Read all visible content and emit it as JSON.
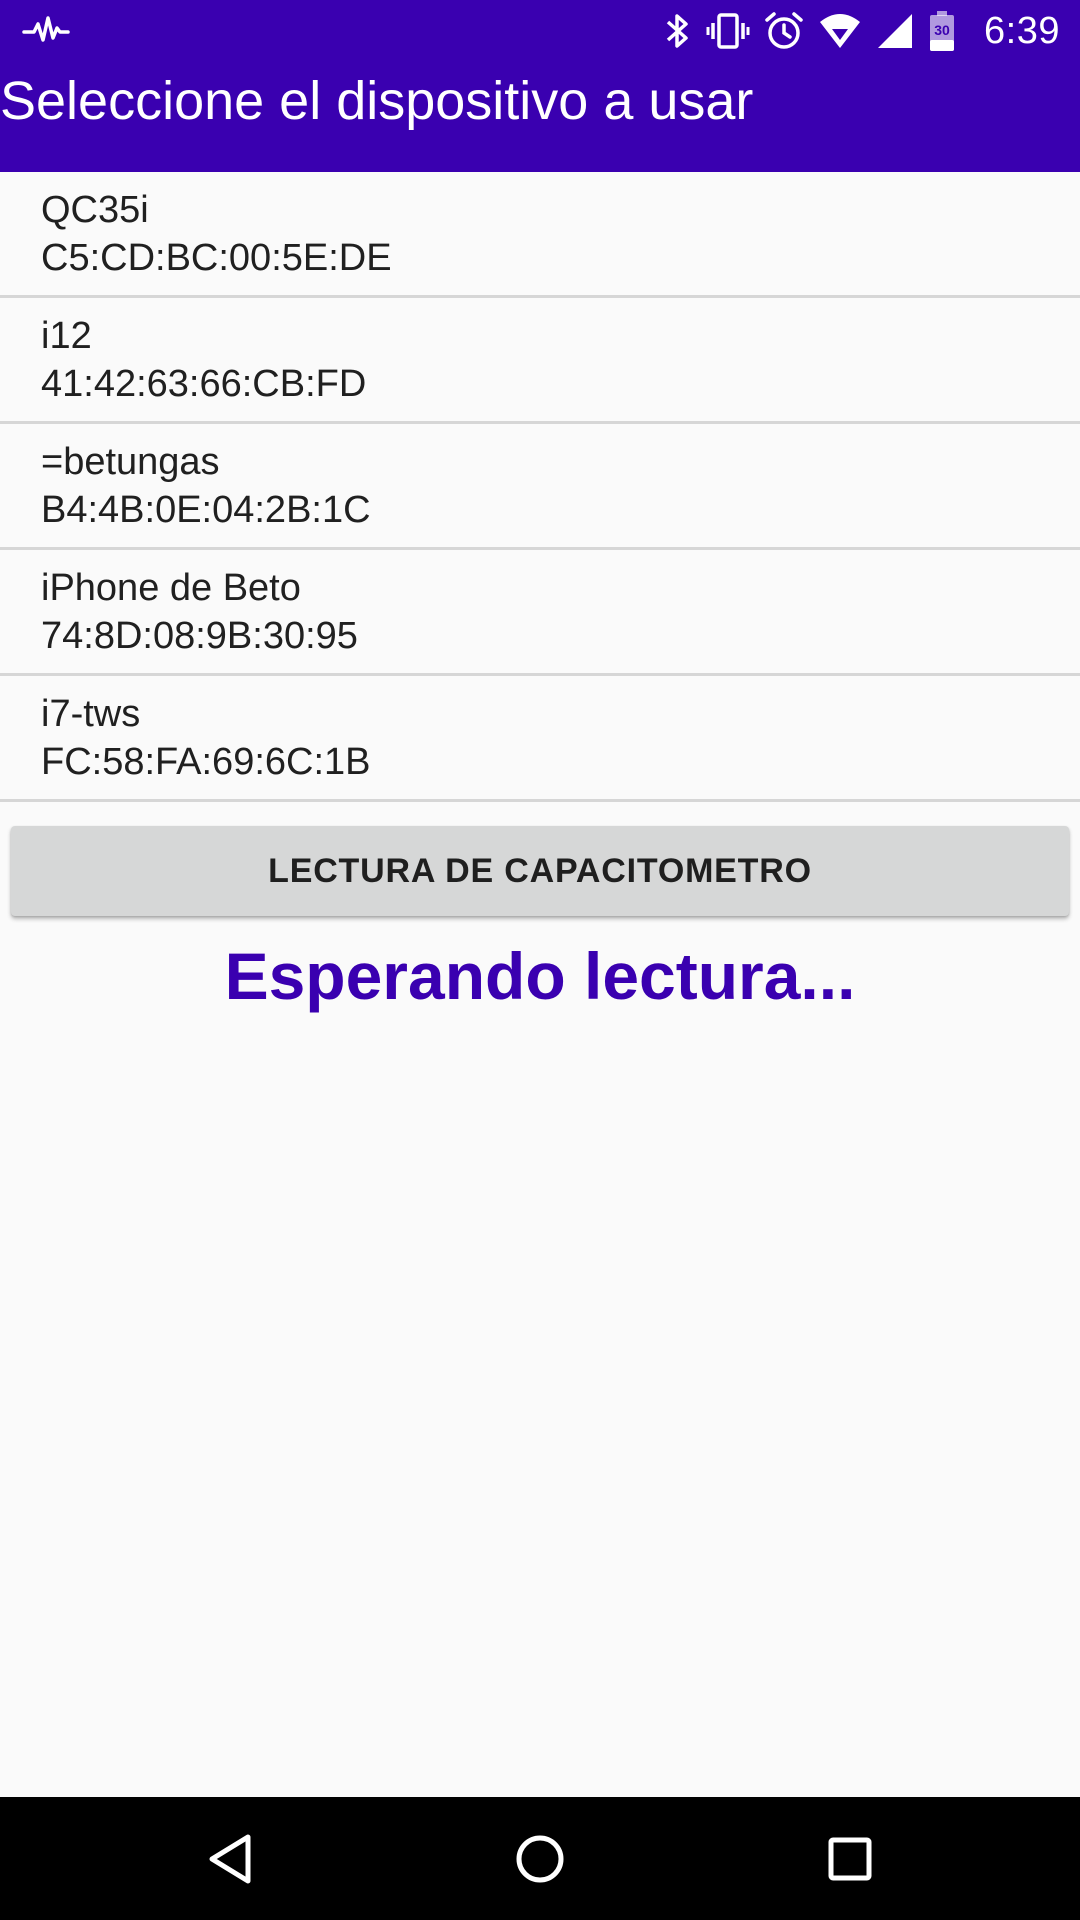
{
  "status_bar": {
    "time": "6:39",
    "battery_level": "30",
    "icons": [
      "heartbeat-icon",
      "bluetooth-icon",
      "vibrate-icon",
      "alarm-icon",
      "wifi-icon",
      "cell-signal-icon",
      "battery-icon"
    ]
  },
  "header": {
    "title": "Seleccione el dispositivo a usar"
  },
  "devices": [
    {
      "name": "QC35i",
      "mac": "C5:CD:BC:00:5E:DE"
    },
    {
      "name": "i12",
      "mac": "41:42:63:66:CB:FD"
    },
    {
      "name": "=betungas",
      "mac": "B4:4B:0E:04:2B:1C"
    },
    {
      "name": "iPhone de Beto",
      "mac": "74:8D:08:9B:30:95"
    },
    {
      "name": "i7-tws",
      "mac": "FC:58:FA:69:6C:1B"
    }
  ],
  "main": {
    "read_button_label": "LECTURA DE CAPACITOMETRO",
    "status_message": "Esperando lectura..."
  },
  "nav": {
    "icons": [
      "back-icon",
      "home-icon",
      "recents-icon"
    ]
  },
  "colors": {
    "primary": "#3a00b0",
    "background": "#fafafa",
    "button": "#d6d7d7",
    "navbar": "#000000"
  }
}
